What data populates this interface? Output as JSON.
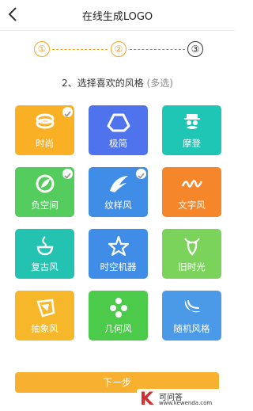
{
  "header": {
    "title": "在线生成LOGO",
    "back_icon": "back-chevron-icon"
  },
  "steps": [
    {
      "label": "①",
      "state": "done"
    },
    {
      "label": "②",
      "state": "done"
    },
    {
      "label": "③",
      "state": "current"
    }
  ],
  "prompt": {
    "text": "2、选择喜欢的风格",
    "hint": "(多选)"
  },
  "styles": [
    {
      "label": "时尚",
      "icon": "stacked-ring-icon",
      "selected": true,
      "color": "#f9b024"
    },
    {
      "label": "极简",
      "icon": "triangle-drive-icon",
      "selected": false,
      "color": "#4f73ec"
    },
    {
      "label": "摩登",
      "icon": "mustache-man-icon",
      "selected": false,
      "color": "#20c6b5"
    },
    {
      "label": "负空间",
      "icon": "leaf-circle-icon",
      "selected": true,
      "color": "#55cc5e"
    },
    {
      "label": "纹样风",
      "icon": "wing-bird-icon",
      "selected": true,
      "color": "#3f8de6"
    },
    {
      "label": "文字风",
      "icon": "script-lettering-icon",
      "selected": false,
      "color": "#f5862a"
    },
    {
      "label": "复古风",
      "icon": "flame-cup-icon",
      "selected": false,
      "color": "#24c2b1"
    },
    {
      "label": "时空机器",
      "icon": "star-outline-icon",
      "selected": false,
      "color": "#3f8de6"
    },
    {
      "label": "旧时光",
      "icon": "deer-icon",
      "selected": false,
      "color": "#7bd35c"
    },
    {
      "label": "抽象风",
      "icon": "abstract-shape-icon",
      "selected": false,
      "color": "#f6b82a"
    },
    {
      "label": "几何风",
      "icon": "hexagon-dots-icon",
      "selected": false,
      "color": "#4ccb4a"
    },
    {
      "label": "随机风格",
      "icon": "swoosh-icon",
      "selected": false,
      "color": "#4a9ae8"
    }
  ],
  "next_button": {
    "label": "下一步"
  },
  "watermark": {
    "letter": "K",
    "name": "可问答",
    "url": "www.kewenda.com"
  },
  "colors": {
    "accent": "#f7b030",
    "check": "#9a9a9a"
  }
}
